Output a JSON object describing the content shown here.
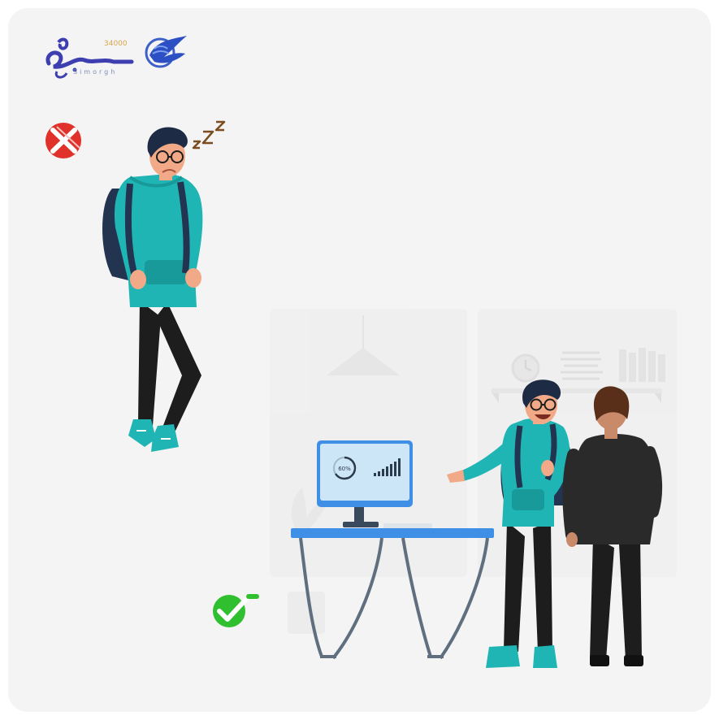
{
  "brand": {
    "name_fa": "سیمرغ",
    "name_en": "Simorgh",
    "number": "34000"
  },
  "monitor": {
    "progress_label": "60%"
  },
  "indicators": {
    "wrong_icon": "red-x-icon",
    "right_icon": "green-check-icon"
  },
  "colors": {
    "hoodie": "#1fb5b4",
    "desk_blue": "#3f8fe6",
    "wrong": "#e0322b",
    "right": "#2fbf2f",
    "card_bg": "#f4f4f4"
  }
}
